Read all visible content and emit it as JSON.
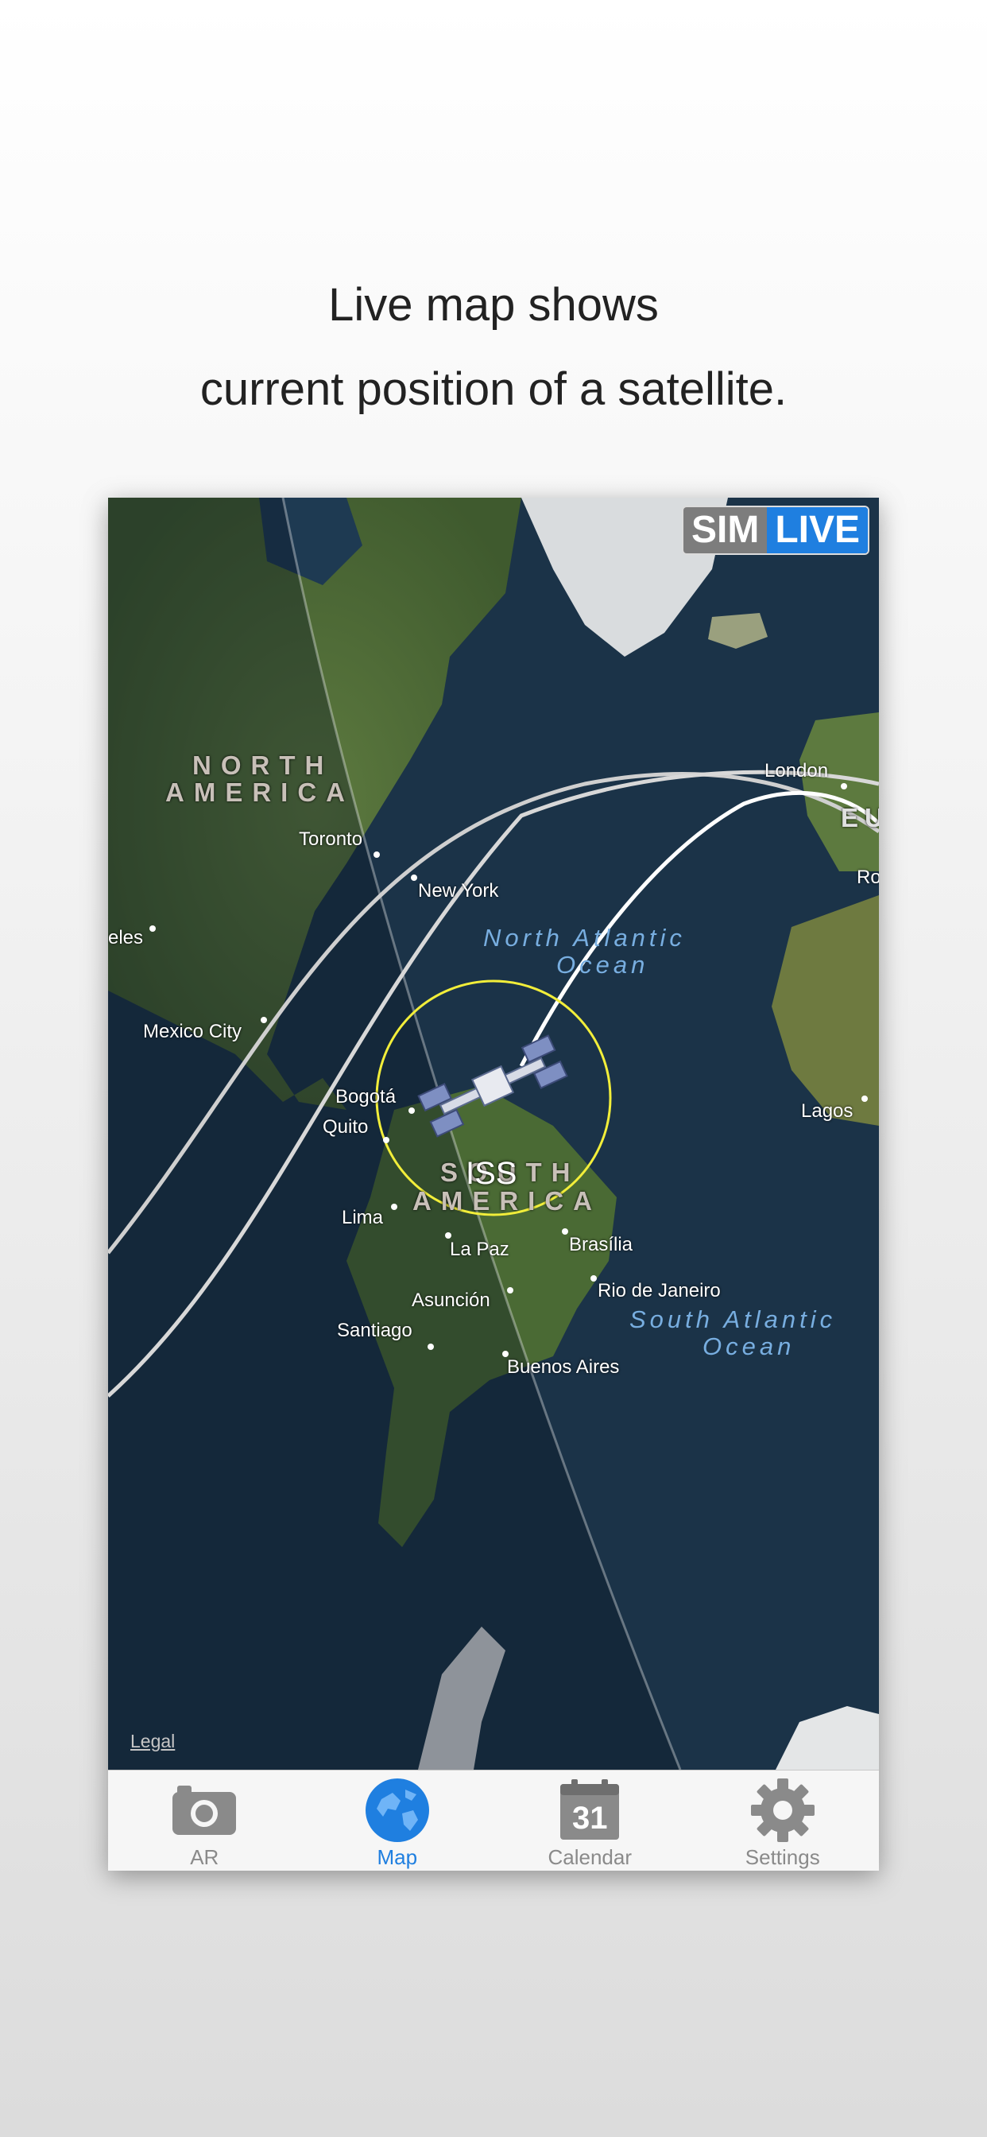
{
  "headline": {
    "line1": "Live map shows",
    "line2": "current position of a satellite."
  },
  "map": {
    "mode_toggle": {
      "sim": "SIM",
      "live": "LIVE",
      "selected": "LIVE"
    },
    "continents": {
      "north_america": [
        "NORTH",
        "AMERICA"
      ],
      "south_america": [
        "SOUTH",
        "AMERICA"
      ],
      "europe_fragment": "EU"
    },
    "oceans": {
      "north_atlantic": [
        "North Atlantic",
        "Ocean"
      ],
      "south_atlantic": [
        "South Atlantic",
        "Ocean"
      ]
    },
    "cities": {
      "london": "London",
      "toronto": "Toronto",
      "new_york": "New York",
      "los_angeles_fragment": "eles",
      "mexico_city": "Mexico City",
      "bogota": "Bogotá",
      "quito": "Quito",
      "lima": "Lima",
      "la_paz": "La Paz",
      "asuncion": "Asunción",
      "santiago": "Santiago",
      "buenos_aires": "Buenos Aires",
      "brasilia": "Brasília",
      "rio": "Rio de Janeiro",
      "lagos": "Lagos",
      "rome_fragment": "Ro"
    },
    "satellite_label": "ISS",
    "legal": "Legal",
    "colors": {
      "ocean": "#1b3348",
      "track": "#ffffff",
      "footprint": "#f2ee3a",
      "accent": "#1f7fe0"
    }
  },
  "tabbar": {
    "items": [
      {
        "label": "AR",
        "icon": "camera-icon",
        "active": false
      },
      {
        "label": "Map",
        "icon": "globe-icon",
        "active": true
      },
      {
        "label": "Calendar",
        "icon": "calendar-icon",
        "active": false,
        "icon_text": "31"
      },
      {
        "label": "Settings",
        "icon": "gear-icon",
        "active": false
      }
    ]
  }
}
